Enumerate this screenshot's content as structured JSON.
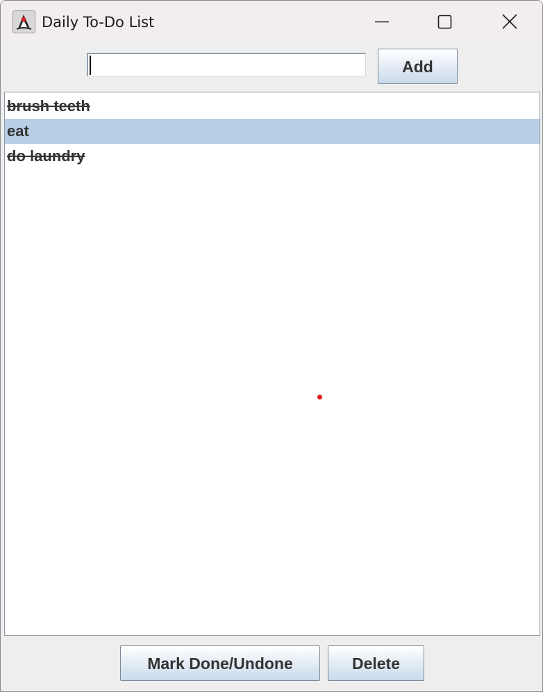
{
  "window": {
    "title": "Daily To-Do List"
  },
  "input_row": {
    "task_value": "",
    "task_placeholder": "",
    "add_label": "Add"
  },
  "tasks": [
    {
      "text": "brush teeth",
      "done": true,
      "selected": false
    },
    {
      "text": "eat",
      "done": false,
      "selected": true
    },
    {
      "text": "do laundry",
      "done": true,
      "selected": false
    }
  ],
  "actions": {
    "mark_label": "Mark Done/Undone",
    "delete_label": "Delete"
  },
  "colors": {
    "selection": "#b8cfe5",
    "text": "#333333",
    "button_gradient_top": "#ffffff",
    "button_gradient_bottom": "#c9d9eb",
    "window_bg": "#eeeeee",
    "titlebar_bg": "#f3eeee",
    "cursor_dot": "#e01818"
  },
  "icons": {
    "app": "java-duke-icon",
    "minimize": "minimize-icon",
    "maximize": "maximize-icon",
    "close": "close-icon"
  }
}
